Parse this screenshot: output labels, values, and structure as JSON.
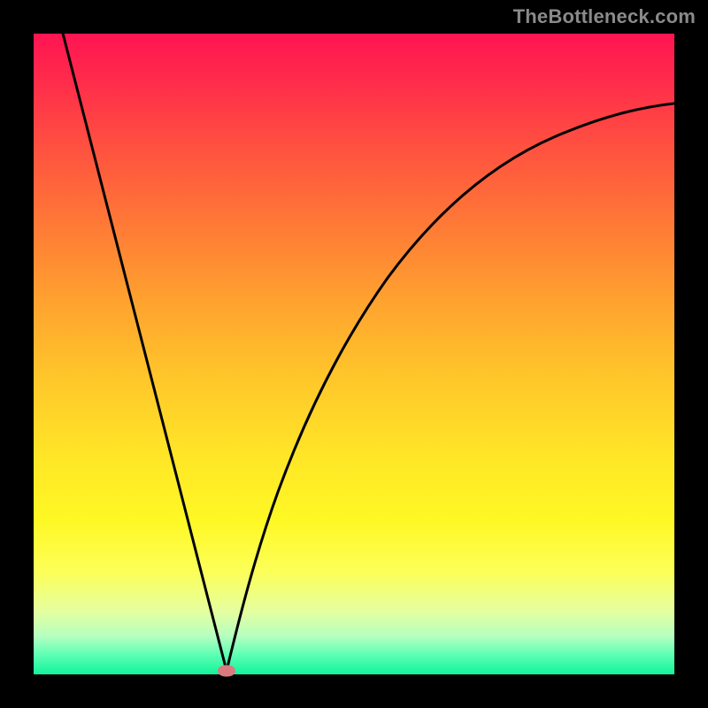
{
  "watermark": "TheBottleneck.com",
  "chart_data": {
    "type": "line",
    "title": "",
    "xlabel": "",
    "ylabel": "",
    "xlim": [
      0,
      100
    ],
    "ylim": [
      0,
      100
    ],
    "legend": false,
    "grid": false,
    "background_gradient": {
      "top_color": "#ff1452",
      "mid_color": "#ffe627",
      "bottom_color": "#12f39b"
    },
    "series": [
      {
        "name": "bottleneck-curve",
        "color": "#000000",
        "x": [
          4,
          8,
          12,
          16,
          20,
          24,
          27,
          29,
          30,
          31,
          33,
          36,
          40,
          46,
          54,
          64,
          76,
          88,
          100
        ],
        "y": [
          100,
          85,
          70,
          55,
          40,
          25,
          12,
          4,
          0,
          4,
          12,
          22,
          34,
          48,
          60,
          70,
          78,
          83,
          86
        ]
      }
    ],
    "marker": {
      "name": "minimum-point",
      "x": 30,
      "y": 0,
      "color": "#d97b7e"
    }
  }
}
